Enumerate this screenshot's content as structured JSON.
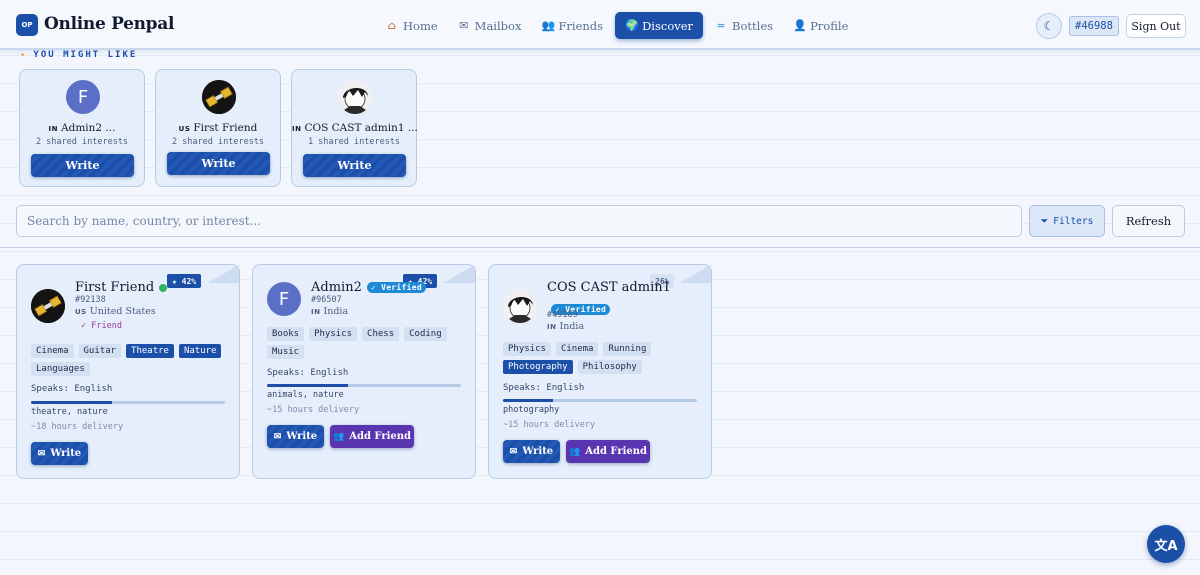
{
  "header": {
    "logo_mark": "OP",
    "app_title": "Online Penpal",
    "nav": [
      {
        "label": "Home",
        "icon": "home-icon"
      },
      {
        "label": "Mailbox",
        "icon": "mail-icon"
      },
      {
        "label": "Friends",
        "icon": "people-icon"
      },
      {
        "label": "Discover",
        "icon": "globe-icon",
        "active": true
      },
      {
        "label": "Bottles",
        "icon": "wave-icon"
      },
      {
        "label": "Profile",
        "icon": "user-icon"
      }
    ],
    "user_id": "#46988",
    "sign_out": "Sign Out"
  },
  "suggestions": {
    "title": "YOU MIGHT LIKE",
    "items": [
      {
        "country": "IN",
        "name": "Admin2 ...",
        "shared": "2 shared interests",
        "write": "Write",
        "avatar_letter": "F"
      },
      {
        "country": "US",
        "name": "First Friend",
        "shared": "2 shared interests",
        "write": "Write"
      },
      {
        "country": "IN",
        "name": "COS CAST admin1 ...",
        "shared": "1 shared interests",
        "write": "Write"
      }
    ]
  },
  "search": {
    "placeholder": "Search by name, country, or interest...",
    "filters": "Filters",
    "refresh": "Refresh"
  },
  "cards": [
    {
      "name": "First Friend",
      "online": true,
      "match": "★ 42%",
      "match_value": 42,
      "id": "#92138",
      "country_code": "US",
      "country": "United States",
      "friend": "✓ Friend",
      "tags": [
        "Cinema",
        "Guitar",
        "Theatre",
        "Nature",
        "Languages"
      ],
      "speaks": "Speaks: English",
      "shared": "theatre, nature",
      "delivery": "~18 hours delivery",
      "write": "Write"
    },
    {
      "name": "Admin2",
      "verified": "✓ Verified",
      "match": "★ 42%",
      "match_value": 42,
      "id": "#96507",
      "country_code": "IN",
      "country": "India",
      "avatar_letter": "F",
      "tags": [
        "Books",
        "Physics",
        "Chess",
        "Coding",
        "Music"
      ],
      "speaks": "Speaks: English",
      "shared": "animals, nature",
      "delivery": "~15 hours delivery",
      "write": "Write",
      "add_friend": "Add Friend"
    },
    {
      "name": "COS CAST admin1",
      "verified": "✓ Verified",
      "match": "26%",
      "match_value": 26,
      "id": "#49189",
      "country_code": "IN",
      "country": "India",
      "tags": [
        "Physics",
        "Cinema",
        "Running",
        "Photography",
        "Philosophy"
      ],
      "speaks": "Speaks: English",
      "shared": "photography",
      "delivery": "~15 hours delivery",
      "write": "Write",
      "add_friend": "Add Friend"
    }
  ],
  "fab": {
    "icon": "translate-icon",
    "label": "文A"
  },
  "colors": {
    "accent": "#1b4fa8",
    "purple": "#5a35b0",
    "online": "#2db55d",
    "verified": "#1e8ad6"
  }
}
